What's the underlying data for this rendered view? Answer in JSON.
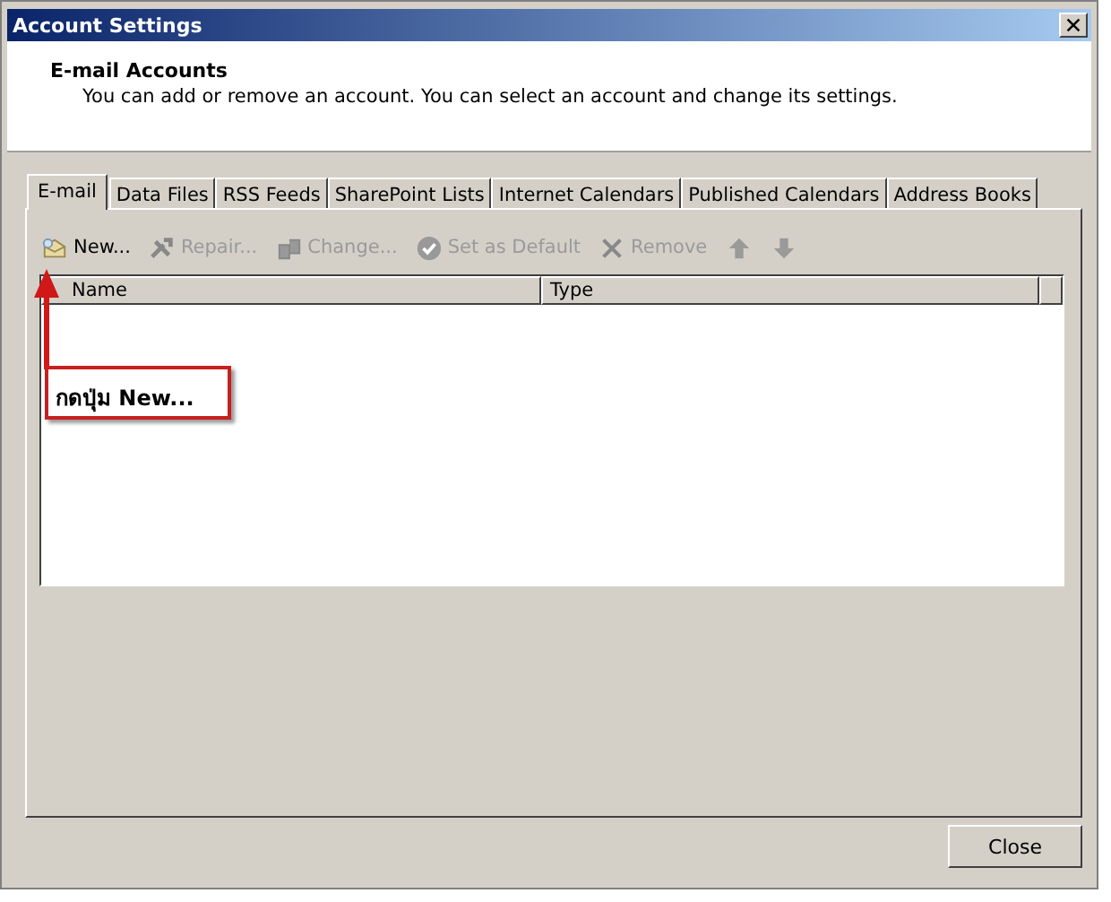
{
  "window": {
    "title": "Account Settings"
  },
  "header": {
    "heading": "E-mail Accounts",
    "description": "You can add or remove an account. You can select an account and change its settings."
  },
  "tabs": [
    {
      "label": "E-mail",
      "selected": true
    },
    {
      "label": "Data Files",
      "selected": false
    },
    {
      "label": "RSS Feeds",
      "selected": false
    },
    {
      "label": "SharePoint Lists",
      "selected": false
    },
    {
      "label": "Internet Calendars",
      "selected": false
    },
    {
      "label": "Published Calendars",
      "selected": false
    },
    {
      "label": "Address Books",
      "selected": false
    }
  ],
  "toolbar": [
    {
      "kind": "new",
      "label": "New...",
      "disabled": false
    },
    {
      "kind": "repair",
      "label": "Repair...",
      "disabled": true
    },
    {
      "kind": "change",
      "label": "Change...",
      "disabled": true
    },
    {
      "kind": "default",
      "label": "Set as Default",
      "disabled": true
    },
    {
      "kind": "remove",
      "label": "Remove",
      "disabled": true
    },
    {
      "kind": "up",
      "disabled": true
    },
    {
      "kind": "down",
      "disabled": true
    }
  ],
  "table": {
    "columns": [
      "Name",
      "Type"
    ]
  },
  "annotation": {
    "text": "กดปุ่ม New..."
  },
  "buttons": [
    "Close"
  ]
}
